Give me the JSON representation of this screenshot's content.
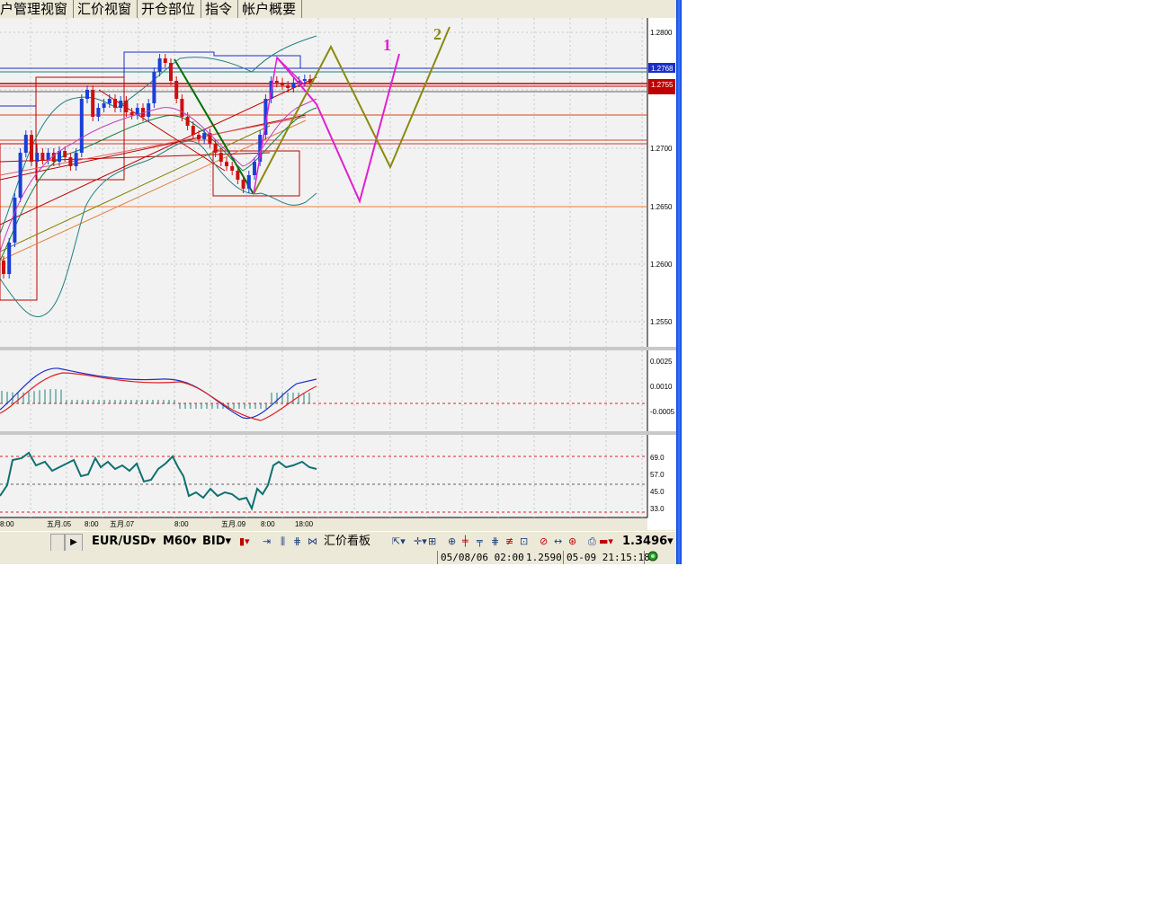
{
  "tabs": [
    "户管理视窗",
    "汇价视窗",
    "开仓部位",
    "指令",
    "帐户概要"
  ],
  "price_axis": {
    "labels": [
      "1.2800",
      "1.2700",
      "1.2650",
      "1.2600",
      "1.2550"
    ],
    "tags": [
      {
        "label": "1.2768",
        "color": "#1a2fc8"
      },
      {
        "label": "1.2755",
        "color": "#c00000"
      }
    ]
  },
  "macd_axis": {
    "labels": [
      "0.0025",
      "0.0010",
      "-0.0005"
    ]
  },
  "rsi_axis": {
    "labels": [
      "69.0",
      "57.0",
      "45.0",
      "33.0"
    ]
  },
  "time_axis": {
    "labels": [
      "8:00",
      "五月.05",
      "8:00",
      "五月.07",
      "8:00",
      "五月.09",
      "8:00",
      "18:00"
    ]
  },
  "annotations": [
    {
      "label": "1",
      "color": "#e020d0"
    },
    {
      "label": "2",
      "color": "#8a8a10"
    }
  ],
  "toolbar": {
    "symbol": "EUR/USD",
    "timeframe": "M60",
    "price_type": "BID",
    "view_board": "汇价看板",
    "quote": "1.3496",
    "dropdown_marker": "▾"
  },
  "statusbar": {
    "cursor_time": "05/08/06 02:00",
    "cursor_price": "1.2590",
    "clock": "05-09 21:15:18"
  },
  "colors": {
    "chart_bg": "#f2f2f2",
    "bull": "#1a3fd8",
    "bear": "#cc1010",
    "annot1": "#e020d0",
    "annot2": "#8a8a10"
  }
}
